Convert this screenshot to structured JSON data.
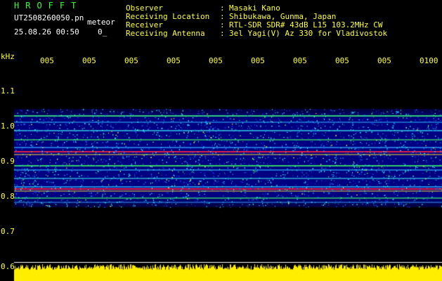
{
  "header": {
    "logo": "HROFFT",
    "filename": "UT2508260050.pn",
    "mode": "meteor",
    "datetime": "25.08.26 00:50",
    "zero_mark": "0_",
    "info": [
      {
        "label": "Observer",
        "value": "Masaki Kano"
      },
      {
        "label": "Receiving Location",
        "value": "Shibukawa, Gunma, Japan"
      },
      {
        "label": "Receiver",
        "value": "RTL-SDR SDR# 43dB L15 103.2MHz CW"
      },
      {
        "label": "Receiving Antenna",
        "value": "3el Yagi(V) Az 330 for Vladivostok"
      }
    ]
  },
  "x_axis": {
    "ticks": [
      "005",
      "005",
      "005",
      "005",
      "005",
      "005",
      "005",
      "005",
      "005",
      "0100"
    ]
  },
  "y_axis": {
    "unit": "kHz",
    "ticks": [
      "1.1",
      "1.0",
      "0.9",
      "0.8",
      "0.7",
      "0.6"
    ]
  },
  "colors": {
    "text_yellow": "#ffff33",
    "text_white": "#ffffff",
    "logo_green": "#33ff33",
    "background": "#000000",
    "spectrogram_base": "#000088",
    "signal_strong": "#ff2040",
    "power_bar": "#ffee00"
  }
}
